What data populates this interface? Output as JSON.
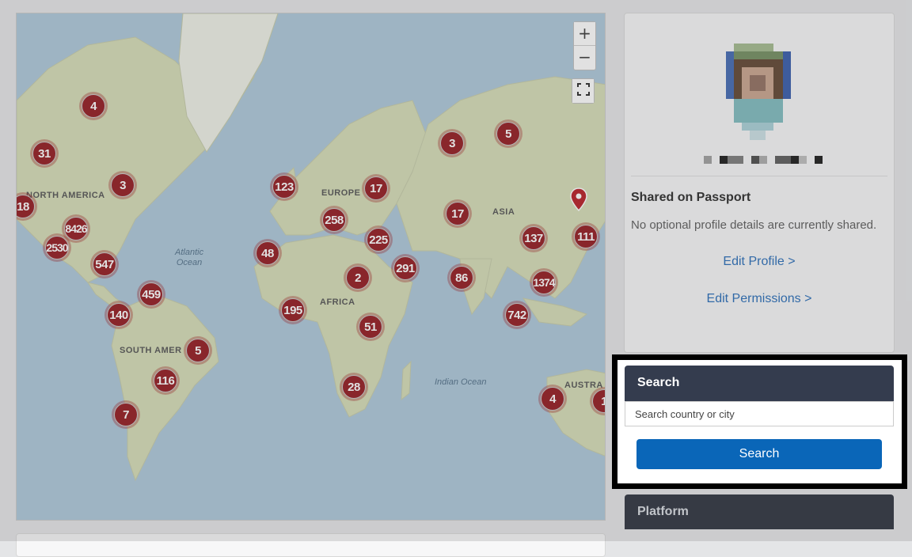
{
  "map": {
    "zoom_in_label": "+",
    "zoom_out_label": "−",
    "fullscreen_icon": "fullscreen-icon",
    "continent_labels": [
      "NORTH AMERICA",
      "EUROPE",
      "ASIA",
      "AFRICA",
      "SOUTH AMER",
      "AUSTRA"
    ],
    "ocean_labels": [
      "Atlantic\nOcean",
      "Indian Ocean"
    ],
    "clusters": [
      {
        "label": "4"
      },
      {
        "label": "31"
      },
      {
        "label": "3"
      },
      {
        "label": "18"
      },
      {
        "label": "8426"
      },
      {
        "label": "2530"
      },
      {
        "label": "547"
      },
      {
        "label": "459"
      },
      {
        "label": "140"
      },
      {
        "label": "5"
      },
      {
        "label": "116"
      },
      {
        "label": "7"
      },
      {
        "label": "123"
      },
      {
        "label": "17"
      },
      {
        "label": "258"
      },
      {
        "label": "225"
      },
      {
        "label": "48"
      },
      {
        "label": "2"
      },
      {
        "label": "291"
      },
      {
        "label": "195"
      },
      {
        "label": "51"
      },
      {
        "label": "28"
      },
      {
        "label": "3"
      },
      {
        "label": "5"
      },
      {
        "label": "17"
      },
      {
        "label": "137"
      },
      {
        "label": "111"
      },
      {
        "label": "86"
      },
      {
        "label": "1374"
      },
      {
        "label": "742"
      },
      {
        "label": "4"
      },
      {
        "label": "1"
      }
    ],
    "colors": {
      "cluster": "#8f1017",
      "water": "#a9c6d9",
      "land": "#d4dcb4"
    }
  },
  "profile": {
    "name": "",
    "shared_heading": "Shared on Passport",
    "shared_text": "No optional profile details are currently shared.",
    "edit_profile_link": "Edit Profile >",
    "edit_permissions_link": "Edit Permissions >"
  },
  "search": {
    "title": "Search",
    "placeholder": "Search country or city",
    "button_label": "Search"
  },
  "platform": {
    "title": "Platform"
  },
  "colors": {
    "link": "#1e66b5",
    "search_header": "#343c4e",
    "search_button": "#0a66b8",
    "platform_header": "#242a37"
  }
}
